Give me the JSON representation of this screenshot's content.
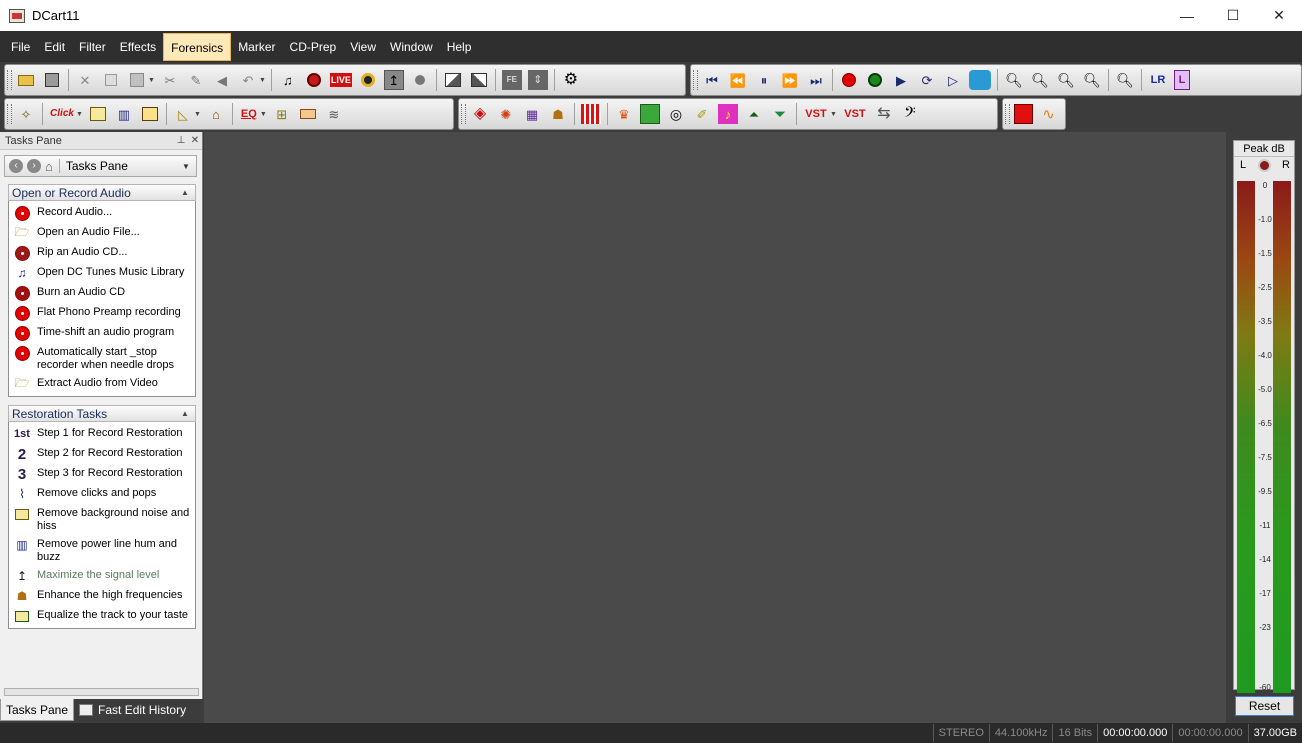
{
  "window": {
    "title": "DCart11",
    "minimize": "—",
    "maximize": "☐",
    "close": "✕"
  },
  "menu": [
    "File",
    "Edit",
    "Filter",
    "Effects",
    "Forensics",
    "Marker",
    "CD-Prep",
    "View",
    "Window",
    "Help"
  ],
  "menu_active": "Forensics",
  "toolbar": {
    "live_label": "LIVE",
    "click_label": "Click",
    "eq_label": "EQ",
    "fe_label": "FE",
    "vst_label": "VST",
    "vst2_label": "VST",
    "lr_label": "LR",
    "l_label": "L"
  },
  "tasks_pane": {
    "title": "Tasks Pane",
    "nav_label": "Tasks Pane",
    "sections": [
      {
        "title": "Open or Record Audio",
        "items": [
          {
            "label": "Record Audio...",
            "icon": "record-icon"
          },
          {
            "label": "Open an Audio File...",
            "icon": "folder-open-icon"
          },
          {
            "label": "Rip an Audio CD...",
            "icon": "cd-rip-icon"
          },
          {
            "label": "Open DC Tunes Music Library",
            "icon": "music-note-icon"
          },
          {
            "label": "Burn an Audio CD",
            "icon": "cd-burn-icon"
          },
          {
            "label": "Flat Phono Preamp recording",
            "icon": "record-icon"
          },
          {
            "label": "Time-shift an audio program",
            "icon": "record-icon"
          },
          {
            "label": "Automatically start _stop recorder when needle drops",
            "icon": "record-icon"
          },
          {
            "label": "Extract Audio from Video",
            "icon": "folder-open-icon"
          }
        ]
      },
      {
        "title": "Restoration Tasks",
        "items": [
          {
            "label": "Step 1 for Record Restoration",
            "icon": "step-1-icon",
            "glyph": "1st"
          },
          {
            "label": "Step 2 for Record Restoration",
            "icon": "step-2-icon",
            "glyph": "2"
          },
          {
            "label": "Step 3 for Record Restoration",
            "icon": "step-3-icon",
            "glyph": "3"
          },
          {
            "label": "Remove clicks and pops",
            "icon": "waveform-icon"
          },
          {
            "label": "Remove background noise and hiss",
            "icon": "noise-icon"
          },
          {
            "label": "Remove power line hum and buzz",
            "icon": "hum-icon"
          },
          {
            "label": "Maximize the signal level",
            "icon": "maximize-icon",
            "dim": true
          },
          {
            "label": "Enhance the high frequencies",
            "icon": "enhance-icon"
          },
          {
            "label": "Equalize the track to your taste",
            "icon": "equalize-icon"
          }
        ]
      }
    ],
    "tabs": [
      "Tasks Pane",
      "Fast Edit History"
    ]
  },
  "meter": {
    "title": "Peak dB",
    "left": "L",
    "right": "R",
    "ticks": [
      "0",
      "-1.0",
      "-1.5",
      "-2.5",
      "-3.5",
      "-4.0",
      "-5.0",
      "-6.5",
      "-7.5",
      "-9.5",
      "-11",
      "-14",
      "-17",
      "-23",
      "-60"
    ],
    "reset": "Reset"
  },
  "status": {
    "channels": "STEREO",
    "rate": "44.100kHz",
    "bits": "16 Bits",
    "time1": "00:00:00.000",
    "time2": "00:00:00.000",
    "disk": "37.00GB"
  },
  "colors": {
    "menubar": "#2f2f2f",
    "workspace": "#4a4a4a",
    "active_menu": "#fde8b8",
    "record_red": "#e00000"
  }
}
